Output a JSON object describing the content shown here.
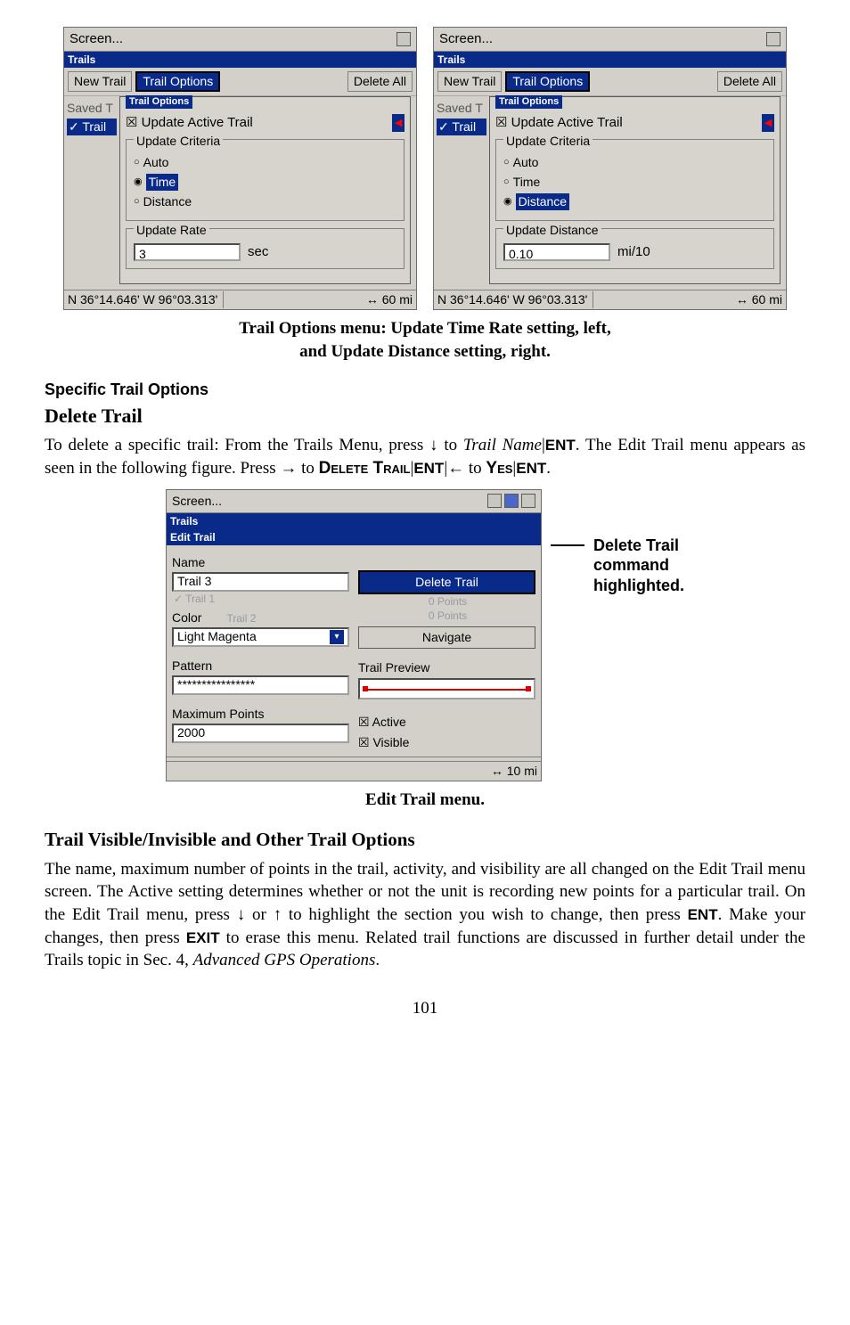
{
  "left_panel": {
    "titlebar": "Screen...",
    "bluebar": "Trails",
    "toolbar": {
      "new_trail": "New Trail",
      "trail_options": "Trail Options",
      "delete_all": "Delete All"
    },
    "side": {
      "saved": "Saved T",
      "trail": "✓ Trail"
    },
    "panel_title": "Trail Options",
    "update_active": "Update Active Trail",
    "criteria_title": "Update Criteria",
    "auto": "Auto",
    "time": "Time",
    "distance": "Distance",
    "rate_title": "Update Rate",
    "rate_value": "3",
    "rate_unit": "sec",
    "status_left": "N   36°14.646'   W   96°03.313'",
    "status_right": "↔   60 mi"
  },
  "right_panel": {
    "titlebar": "Screen...",
    "bluebar": "Trails",
    "toolbar": {
      "new_trail": "New Trail",
      "trail_options": "Trail Options",
      "delete_all": "Delete All"
    },
    "side": {
      "saved": "Saved T",
      "trail": "✓ Trail"
    },
    "panel_title": "Trail Options",
    "update_active": "Update Active Trail",
    "criteria_title": "Update Criteria",
    "auto": "Auto",
    "time": "Time",
    "distance": "Distance",
    "dist_title": "Update Distance",
    "dist_value": "0.10",
    "dist_unit": "mi/10",
    "status_left": "N   36°14.646'   W   96°03.313'",
    "status_right": "↔   60 mi"
  },
  "caption1a": "Trail Options menu: Update Time Rate setting, left,",
  "caption1b": "and Update Distance setting, right.",
  "sec_heading": "Specific Trail Options",
  "del_heading": "Delete Trail",
  "p1a": "To delete a specific trail: From the Trails Menu, press ↓ to ",
  "p1b": "Trail Name",
  "p1c": "|",
  "p1_ent": "ENT",
  "p1d": ". The Edit Trail menu appears as seen in the following figure. Press → to ",
  "p1_delete": "Delete Trail",
  "p1_sep": "|",
  "p1_ent2": "ENT",
  "p1_sep2": "|← to ",
  "p1_yes": "Yes",
  "p1_sep3": "|",
  "p1_ent3": "ENT",
  "p1_end": ".",
  "edit": {
    "titlebar": "Screen...",
    "bluebar": "Trails",
    "header": "Edit Trail",
    "name_lbl": "Name",
    "name_val": "Trail 3",
    "ghost1": "✓ Trail 1",
    "ghost2": "Trail 2",
    "color_lbl": "Color",
    "color_val": "Light Magenta",
    "pattern_lbl": "Pattern",
    "pattern_val": "****************",
    "maxpts_lbl": "Maximum Points",
    "maxpts_val": "2000",
    "delete_btn": "Delete Trail",
    "pts0a": "0 Points",
    "pts0b": "0 Points",
    "navigate": "Navigate",
    "preview_lbl": "Trail Preview",
    "active": "Active",
    "visible": "Visible",
    "status_right": "↔   10 mi"
  },
  "annot1": "Delete Trail",
  "annot2": "command",
  "annot3": "highlighted.",
  "caption2": "Edit Trail menu.",
  "vis_heading": "Trail Visible/Invisible and Other Trail Options",
  "p2": "The name, maximum number of points in the trail, activity, and visibility are all changed on the Edit Trail menu screen. The Active setting determines whether or not the unit is recording new points for a particular trail. On the Edit Trail menu, press ↓ or ↑ to highlight the section you wish to change, then press ",
  "p2_ent": "ENT",
  "p2b": ". Make your changes, then press ",
  "p2_exit": "EXIT",
  "p2c": " to erase this menu. Related trail functions are discussed in further detail under the Trails topic in Sec. 4, ",
  "p2_ital": "Advanced GPS Operations",
  "p2d": ".",
  "pagenum": "101"
}
